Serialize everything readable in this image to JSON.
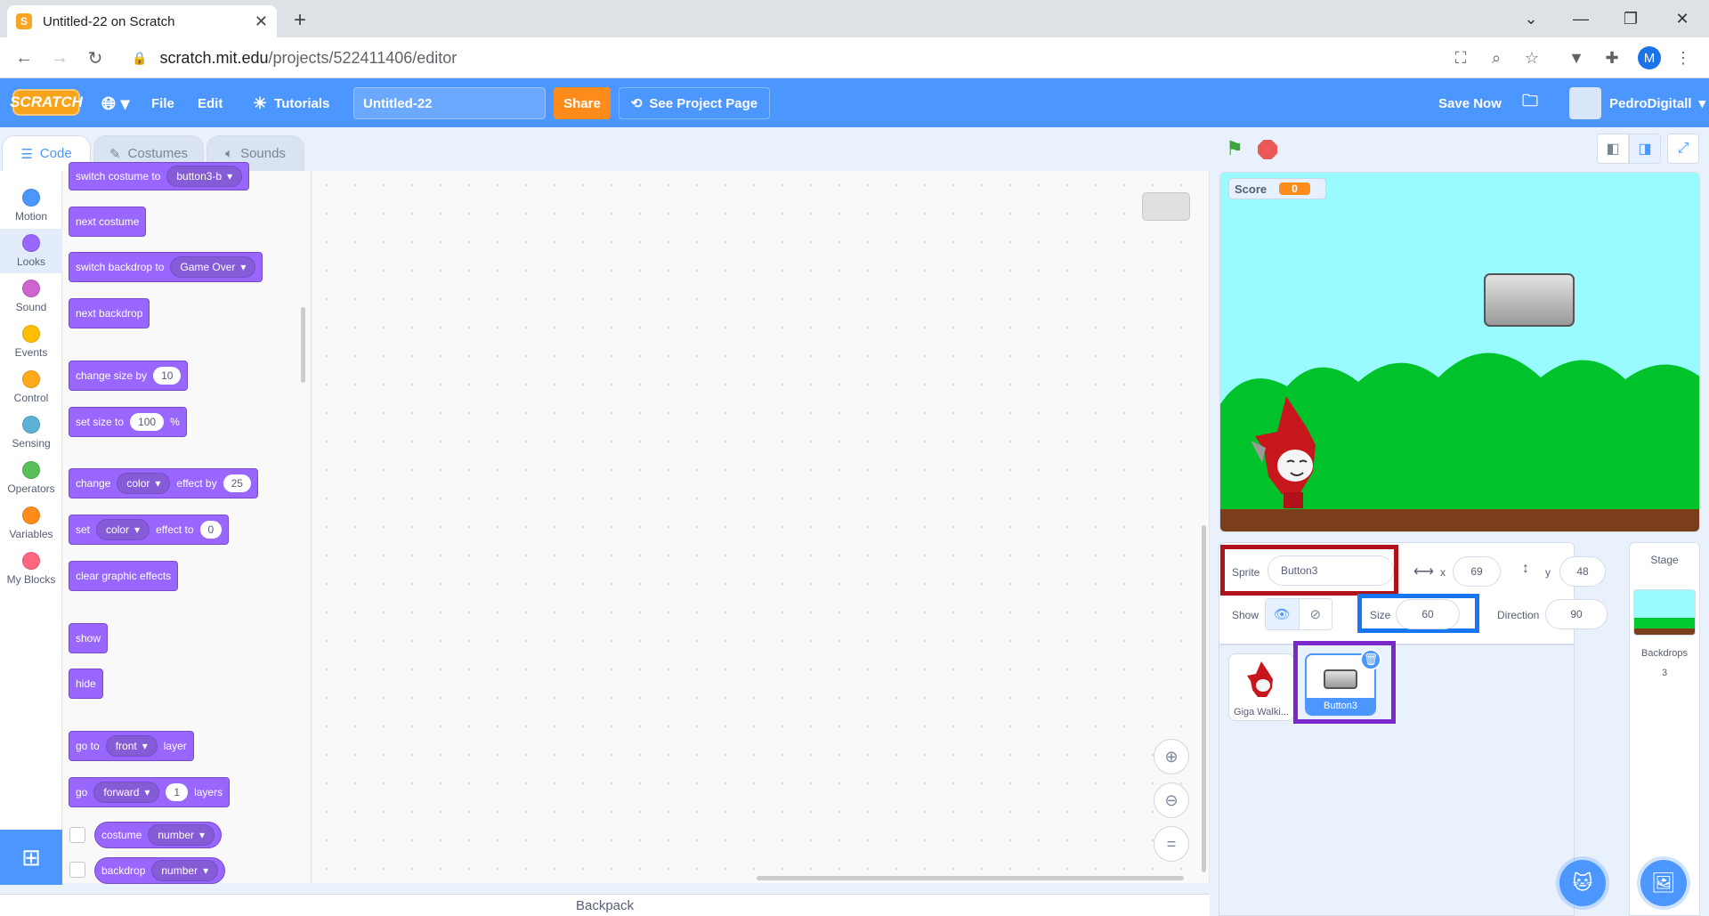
{
  "browser": {
    "tab_title": "Untitled-22 on Scratch",
    "url_host": "scratch.mit.edu",
    "url_path": "/projects/522411406/editor",
    "profile_initial": "M"
  },
  "menu": {
    "logo": "SCRATCH",
    "file": "File",
    "edit": "Edit",
    "tutorials": "Tutorials",
    "project_title": "Untitled-22",
    "share": "Share",
    "see_project": "See Project Page",
    "save_now": "Save Now",
    "username": "PedroDigitall"
  },
  "tabs": {
    "code": "Code",
    "costumes": "Costumes",
    "sounds": "Sounds"
  },
  "categories": [
    {
      "label": "Motion",
      "color": "#4c97ff"
    },
    {
      "label": "Looks",
      "color": "#9966ff"
    },
    {
      "label": "Sound",
      "color": "#cf63cf"
    },
    {
      "label": "Events",
      "color": "#ffbf00"
    },
    {
      "label": "Control",
      "color": "#ffab19"
    },
    {
      "label": "Sensing",
      "color": "#5cb1d6"
    },
    {
      "label": "Operators",
      "color": "#59c059"
    },
    {
      "label": "Variables",
      "color": "#ff8c1a"
    },
    {
      "label": "My Blocks",
      "color": "#ff6680"
    }
  ],
  "blocks": {
    "switch_costume": {
      "text": "switch costume to",
      "value": "button3-b"
    },
    "next_costume": "next costume",
    "switch_backdrop": {
      "text": "switch backdrop to",
      "value": "Game Over"
    },
    "next_backdrop": "next backdrop",
    "change_size": {
      "text": "change size by",
      "value": "10"
    },
    "set_size": {
      "text": "set size to",
      "value": "100",
      "unit": "%"
    },
    "change_effect": {
      "a": "change",
      "effect": "color",
      "b": "effect by",
      "value": "25"
    },
    "set_effect": {
      "a": "set",
      "effect": "color",
      "b": "effect to",
      "value": "0"
    },
    "clear_effects": "clear graphic effects",
    "show": "show",
    "hide": "hide",
    "go_to_layer": {
      "a": "go to",
      "value": "front",
      "b": "layer"
    },
    "go_layers": {
      "a": "go",
      "dir": "forward",
      "value": "1",
      "b": "layers"
    },
    "costume_rep": {
      "text": "costume",
      "value": "number"
    },
    "backdrop_rep": {
      "text": "backdrop",
      "value": "number"
    }
  },
  "backpack": "Backpack",
  "stage": {
    "score_label": "Score",
    "score_value": "0"
  },
  "sprite_info": {
    "sprite_label": "Sprite",
    "sprite_name": "Button3",
    "x_label": "x",
    "x": "69",
    "y_label": "y",
    "y": "48",
    "show_label": "Show",
    "size_label": "Size",
    "size": "60",
    "direction_label": "Direction",
    "direction": "90"
  },
  "sprites": [
    {
      "name": "Giga Walki..."
    },
    {
      "name": "Button3"
    }
  ],
  "stage_pane": {
    "label": "Stage",
    "backdrops_label": "Backdrops",
    "backdrops_count": "3"
  },
  "colors": {
    "scratch_blue": "#4c97ff",
    "looks_purple": "#9966ff",
    "highlight_red": "#b0121b",
    "highlight_blue": "#1976f2",
    "highlight_purple": "#7a28c9"
  }
}
